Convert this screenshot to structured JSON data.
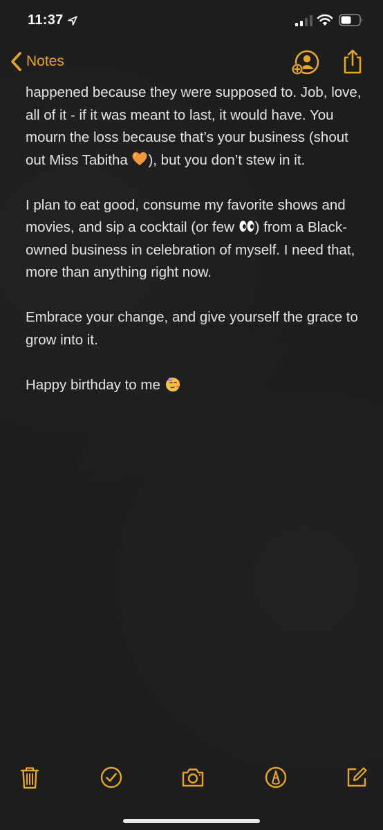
{
  "status_bar": {
    "time": "11:37"
  },
  "nav": {
    "back_label": "Notes"
  },
  "note": {
    "paragraphs": [
      {
        "text_a": "happened because they were supposed to. Job, love, all of it - if it was meant to last, it would have. You mourn the loss because that’s your business (shout out Miss Tabitha ",
        "emoji": "orange-heart",
        "text_b": "), but you don’t stew in it."
      },
      {
        "text_a": "I plan to eat good, consume my favorite shows and movies, and sip a cocktail (or few ",
        "emoji": "eyes",
        "text_b": ") from a Black-owned business in celebration of myself. I need that, more than anything right now."
      },
      {
        "text": "Embrace your change, and give yourself the grace to grow into it."
      },
      {
        "text_a": "Happy birthday to me ",
        "emoji": "partying-face"
      }
    ]
  },
  "toolbar": {
    "items": [
      "trash-icon",
      "checklist-icon",
      "camera-icon",
      "markup-icon",
      "compose-icon"
    ]
  },
  "colors": {
    "accent": "#e6a728",
    "background": "#1d1d1e",
    "text": "#e4e4e4"
  }
}
